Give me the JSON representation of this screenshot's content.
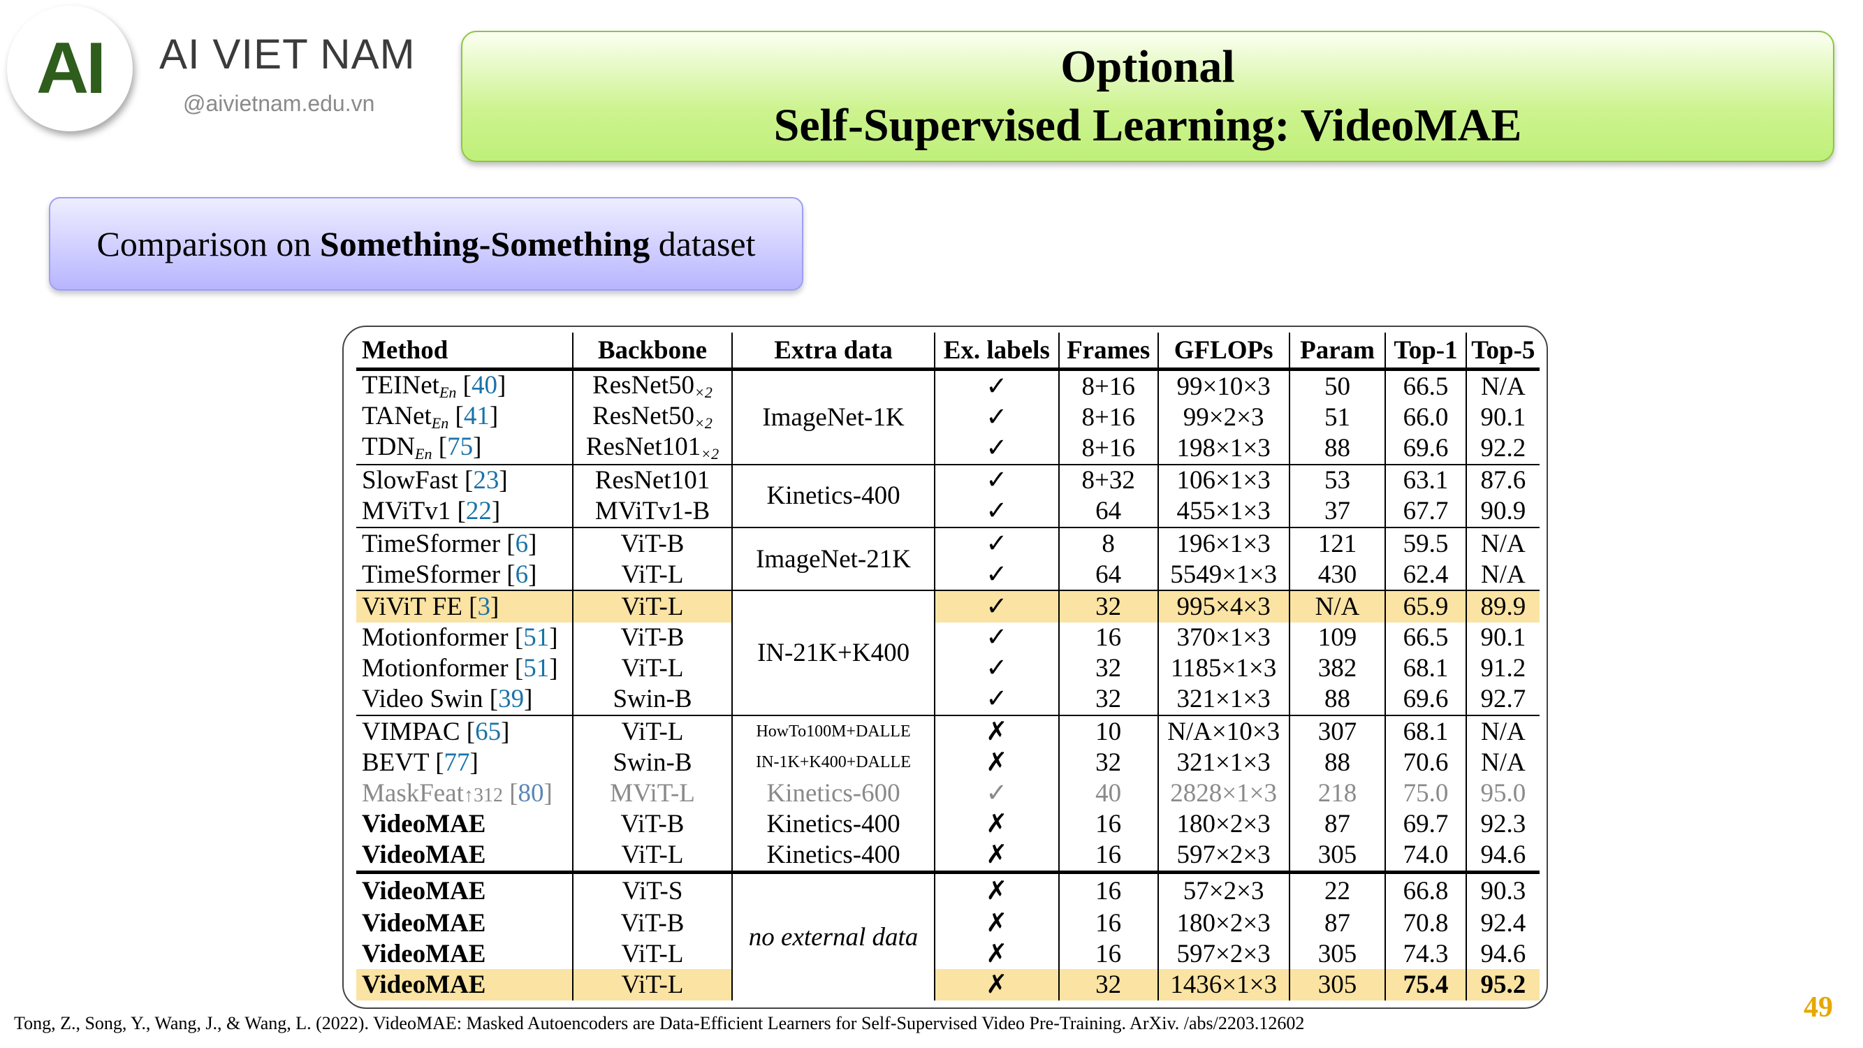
{
  "brand": {
    "logo_text": "AI",
    "name": "AI VIET NAM",
    "url": "@aivietnam.edu.vn"
  },
  "title": {
    "line1": "Optional",
    "line2": "Self-Supervised Learning: VideoMAE"
  },
  "subtitle": {
    "prefix": "Comparison on ",
    "bold": "Something-Something",
    "suffix": " dataset"
  },
  "table": {
    "headers": [
      "Method",
      "Backbone",
      "Extra data",
      "Ex. labels",
      "Frames",
      "GFLOPs",
      "Param",
      "Top-1",
      "Top-5"
    ],
    "rows": [
      {
        "method": "TEINet",
        "method_sub": "En",
        "ref": "40",
        "backbone": "ResNet50",
        "backbone_sub": "×2",
        "extra": "ImageNet-1K",
        "label": "✓",
        "frames": "8+16",
        "gflops": "99×10×3",
        "param": "50",
        "top1": "66.5",
        "top5": "N/A"
      },
      {
        "method": "TANet",
        "method_sub": "En",
        "ref": "41",
        "backbone": "ResNet50",
        "backbone_sub": "×2",
        "label": "✓",
        "frames": "8+16",
        "gflops": "99×2×3",
        "param": "51",
        "top1": "66.0",
        "top5": "90.1"
      },
      {
        "method": "TDN",
        "method_sub": "En",
        "ref": "75",
        "backbone": "ResNet101",
        "backbone_sub": "×2",
        "label": "✓",
        "frames": "8+16",
        "gflops": "198×1×3",
        "param": "88",
        "top1": "69.6",
        "top5": "92.2"
      },
      {
        "method": "SlowFast",
        "ref": "23",
        "backbone": "ResNet101",
        "extra": "Kinetics-400",
        "label": "✓",
        "frames": "8+32",
        "gflops": "106×1×3",
        "param": "53",
        "top1": "63.1",
        "top5": "87.6"
      },
      {
        "method": "MViTv1",
        "ref": "22",
        "backbone": "MViTv1-B",
        "label": "✓",
        "frames": "64",
        "gflops": "455×1×3",
        "param": "37",
        "top1": "67.7",
        "top5": "90.9"
      },
      {
        "method": "TimeSformer",
        "ref": "6",
        "backbone": "ViT-B",
        "extra": "ImageNet-21K",
        "label": "✓",
        "frames": "8",
        "gflops": "196×1×3",
        "param": "121",
        "top1": "59.5",
        "top5": "N/A"
      },
      {
        "method": "TimeSformer",
        "ref": "6",
        "backbone": "ViT-L",
        "label": "✓",
        "frames": "64",
        "gflops": "5549×1×3",
        "param": "430",
        "top1": "62.4",
        "top5": "N/A"
      },
      {
        "method": "ViViT FE",
        "ref": "3",
        "backbone": "ViT-L",
        "extra": "IN-21K+K400",
        "label": "✓",
        "frames": "32",
        "gflops": "995×4×3",
        "param": "N/A",
        "top1": "65.9",
        "top5": "89.9"
      },
      {
        "method": "Motionformer",
        "ref": "51",
        "backbone": "ViT-B",
        "label": "✓",
        "frames": "16",
        "gflops": "370×1×3",
        "param": "109",
        "top1": "66.5",
        "top5": "90.1"
      },
      {
        "method": "Motionformer",
        "ref": "51",
        "backbone": "ViT-L",
        "label": "✓",
        "frames": "32",
        "gflops": "1185×1×3",
        "param": "382",
        "top1": "68.1",
        "top5": "91.2"
      },
      {
        "method": "Video Swin",
        "ref": "39",
        "backbone": "Swin-B",
        "label": "✓",
        "frames": "32",
        "gflops": "321×1×3",
        "param": "88",
        "top1": "69.6",
        "top5": "92.7"
      },
      {
        "method": "VIMPAC",
        "ref": "65",
        "backbone": "ViT-L",
        "extra": "HowTo100M+DALLE",
        "label": "✗",
        "frames": "10",
        "gflops": "N/A×10×3",
        "param": "307",
        "top1": "68.1",
        "top5": "N/A"
      },
      {
        "method": "BEVT",
        "ref": "77",
        "backbone": "Swin-B",
        "extra": "IN-1K+K400+DALLE",
        "label": "✗",
        "frames": "32",
        "gflops": "321×1×3",
        "param": "88",
        "top1": "70.6",
        "top5": "N/A"
      },
      {
        "method": "MaskFeat",
        "method_sub": "↑312",
        "ref": "80",
        "backbone": "MViT-L",
        "extra": "Kinetics-600",
        "label": "✓",
        "frames": "40",
        "gflops": "2828×1×3",
        "param": "218",
        "top1": "75.0",
        "top5": "95.0"
      },
      {
        "method": "VideoMAE",
        "backbone": "ViT-B",
        "extra": "Kinetics-400",
        "label": "✗",
        "frames": "16",
        "gflops": "180×2×3",
        "param": "87",
        "top1": "69.7",
        "top5": "92.3"
      },
      {
        "method": "VideoMAE",
        "backbone": "ViT-L",
        "extra": "Kinetics-400",
        "label": "✗",
        "frames": "16",
        "gflops": "597×2×3",
        "param": "305",
        "top1": "74.0",
        "top5": "94.6"
      },
      {
        "method": "VideoMAE",
        "backbone": "ViT-S",
        "extra": "no external data",
        "label": "✗",
        "frames": "16",
        "gflops": "57×2×3",
        "param": "22",
        "top1": "66.8",
        "top5": "90.3"
      },
      {
        "method": "VideoMAE",
        "backbone": "ViT-B",
        "label": "✗",
        "frames": "16",
        "gflops": "180×2×3",
        "param": "87",
        "top1": "70.8",
        "top5": "92.4"
      },
      {
        "method": "VideoMAE",
        "backbone": "ViT-L",
        "label": "✗",
        "frames": "16",
        "gflops": "597×2×3",
        "param": "305",
        "top1": "74.3",
        "top5": "94.6"
      },
      {
        "method": "VideoMAE",
        "backbone": "ViT-L",
        "label": "✗",
        "frames": "32",
        "gflops": "1436×1×3",
        "param": "305",
        "top1": "75.4",
        "top5": "95.2"
      }
    ]
  },
  "page_number": "49",
  "citation": "Tong, Z., Song, Y., Wang, J., & Wang, L. (2022). VideoMAE: Masked Autoencoders are Data-Efficient Learners for Self-Supervised Video Pre-Training. ArXiv. /abs/2203.12602",
  "colors": {
    "title_green": "#c6f286",
    "subtitle_purple": "#b8b5ff",
    "highlight": "#fae3a3",
    "ref_blue": "#1a73a8",
    "page_num": "#e6a800"
  }
}
